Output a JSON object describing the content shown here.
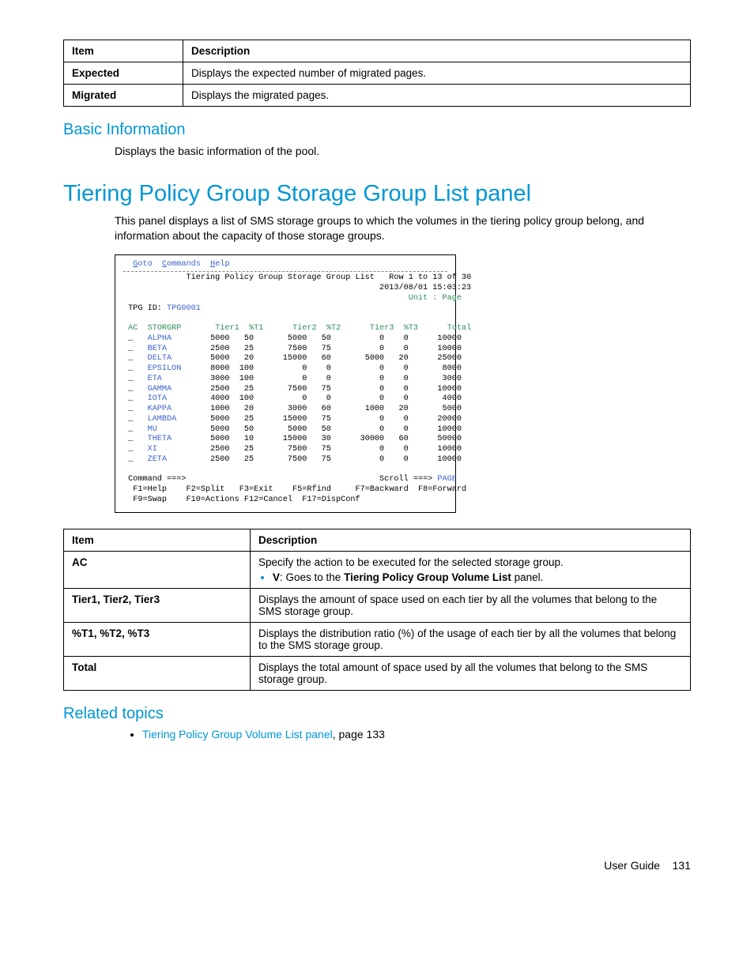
{
  "table1": {
    "header": {
      "item": "Item",
      "desc": "Description"
    },
    "rows": [
      {
        "item": "Expected",
        "desc": "Displays the expected number of migrated pages."
      },
      {
        "item": "Migrated",
        "desc": "Displays the migrated pages."
      }
    ]
  },
  "basic_info": {
    "heading": "Basic Information",
    "text": "Displays the basic information of the pool."
  },
  "main_heading": "Tiering Policy Group Storage Group List panel",
  "main_intro": "This panel displays a list of SMS storage groups to which the volumes in the tiering policy group belong, and information about the capacity of those storage groups.",
  "terminal": {
    "menu_goto": "Goto",
    "menu_commands": "Commands",
    "menu_help": "Help",
    "title": "Tiering Policy Group Storage Group List",
    "row_info": "Row 1 to 13 of 30",
    "timestamp": "2013/08/01 15:03:23",
    "unit": "Unit : Page",
    "tpg_id_label": "TPG ID:",
    "tpg_id_value": "TPG0001",
    "cols": {
      "ac": "AC",
      "storgrp": "STORGRP",
      "t1": "Tier1",
      "p1": "%T1",
      "t2": "Tier2",
      "p2": "%T2",
      "t3": "Tier3",
      "p3": "%T3",
      "tot": "Total"
    },
    "rows": [
      {
        "name": "ALPHA",
        "t1": 5000,
        "p1": 50,
        "t2": 5000,
        "p2": 50,
        "t3": 0,
        "p3": 0,
        "tot": 10000
      },
      {
        "name": "BETA",
        "t1": 2500,
        "p1": 25,
        "t2": 7500,
        "p2": 75,
        "t3": 0,
        "p3": 0,
        "tot": 10000
      },
      {
        "name": "DELTA",
        "t1": 5000,
        "p1": 20,
        "t2": 15000,
        "p2": 60,
        "t3": 5000,
        "p3": 20,
        "tot": 25000
      },
      {
        "name": "EPSILON",
        "t1": 8000,
        "p1": 100,
        "t2": 0,
        "p2": 0,
        "t3": 0,
        "p3": 0,
        "tot": 8000
      },
      {
        "name": "ETA",
        "t1": 3000,
        "p1": 100,
        "t2": 0,
        "p2": 0,
        "t3": 0,
        "p3": 0,
        "tot": 3000
      },
      {
        "name": "GAMMA",
        "t1": 2500,
        "p1": 25,
        "t2": 7500,
        "p2": 75,
        "t3": 0,
        "p3": 0,
        "tot": 10000
      },
      {
        "name": "IOTA",
        "t1": 4000,
        "p1": 100,
        "t2": 0,
        "p2": 0,
        "t3": 0,
        "p3": 0,
        "tot": 4000
      },
      {
        "name": "KAPPA",
        "t1": 1000,
        "p1": 20,
        "t2": 3000,
        "p2": 60,
        "t3": 1000,
        "p3": 20,
        "tot": 5000
      },
      {
        "name": "LAMBDA",
        "t1": 5000,
        "p1": 25,
        "t2": 15000,
        "p2": 75,
        "t3": 0,
        "p3": 0,
        "tot": 20000
      },
      {
        "name": "MU",
        "t1": 5000,
        "p1": 50,
        "t2": 5000,
        "p2": 50,
        "t3": 0,
        "p3": 0,
        "tot": 10000
      },
      {
        "name": "THETA",
        "t1": 5000,
        "p1": 10,
        "t2": 15000,
        "p2": 30,
        "t3": 30000,
        "p3": 60,
        "tot": 50000
      },
      {
        "name": "XI",
        "t1": 2500,
        "p1": 25,
        "t2": 7500,
        "p2": 75,
        "t3": 0,
        "p3": 0,
        "tot": 10000
      },
      {
        "name": "ZETA",
        "t1": 2500,
        "p1": 25,
        "t2": 7500,
        "p2": 75,
        "t3": 0,
        "p3": 0,
        "tot": 10000
      }
    ],
    "command_prompt": "Command ===>",
    "scroll": "Scroll ===> ",
    "scroll_val": "PAGE",
    "fkeys_line1": {
      "f1": "F1=Help",
      "f2": "F2=Split",
      "f3": "F3=Exit",
      "f5": "F5=Rfind",
      "f7": "F7=Backward",
      "f8": "F8=Forward"
    },
    "fkeys_line2": {
      "f9": "F9=Swap",
      "f10": "F10=Actions",
      "f12": "F12=Cancel",
      "f17": "F17=DispConf"
    }
  },
  "table2": {
    "header": {
      "item": "Item",
      "desc": "Description"
    },
    "rows": [
      {
        "item": "AC",
        "desc": "Specify the action to be executed for the selected storage group.",
        "bullet_v": "V",
        "bullet_rest": ": Goes to the ",
        "bullet_bold": "Tiering Policy Group Volume List",
        "bullet_tail": " panel."
      },
      {
        "item": "Tier1, Tier2, Tier3",
        "desc": "Displays the amount of space used on each tier by all the volumes that belong to the SMS storage group."
      },
      {
        "item": "%T1, %T2, %T3",
        "desc": "Displays the distribution ratio (%) of the usage of each tier by all the volumes that belong to the SMS storage group."
      },
      {
        "item": "Total",
        "desc": "Displays the total amount of space used by all the volumes that belong to the SMS storage group."
      }
    ]
  },
  "related": {
    "heading": "Related topics",
    "link_text": "Tiering Policy Group Volume List panel",
    "page_ref": ", page 133"
  },
  "footer": {
    "label": "User Guide",
    "page": "131"
  }
}
